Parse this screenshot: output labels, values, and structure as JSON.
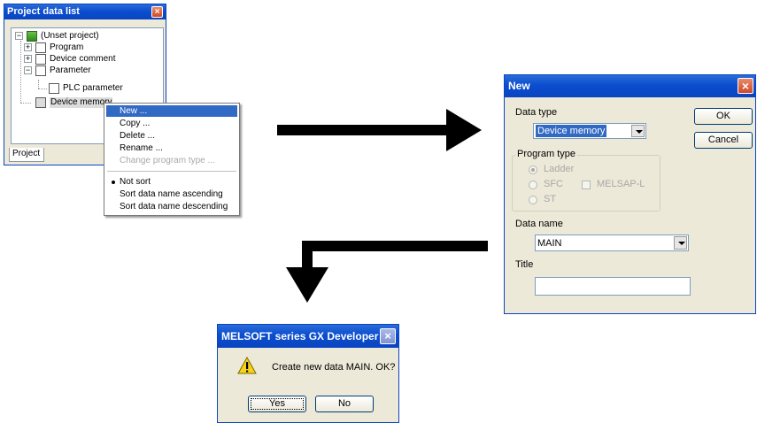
{
  "project_window": {
    "title": "Project data list",
    "tree": {
      "root": "(Unset project)",
      "program": "Program",
      "device_comment": "Device comment",
      "parameter": "Parameter",
      "plc_parameter": "PLC parameter",
      "device_memory": "Device memory"
    },
    "tab": "Project"
  },
  "context_menu": {
    "items": [
      "New ...",
      "Copy ...",
      "Delete ...",
      "Rename ...",
      "Change program type ..."
    ],
    "sort_items": [
      "Not sort",
      "Sort data name ascending",
      "Sort data name descending"
    ]
  },
  "new_dialog": {
    "title": "New",
    "data_type_label": "Data type",
    "data_type_value": "Device memory",
    "ok": "OK",
    "cancel": "Cancel",
    "program_type_label": "Program type",
    "ladder": "Ladder",
    "sfc": "SFC",
    "melsap": "MELSAP-L",
    "st": "ST",
    "data_name_label": "Data name",
    "data_name_value": "MAIN",
    "title_label": "Title",
    "title_value": ""
  },
  "confirm_dialog": {
    "title": "MELSOFT series GX Developer",
    "message": "Create new data MAIN. OK?",
    "yes": "Yes",
    "no": "No"
  },
  "colors": {
    "titlebar": "#0a45c0",
    "menu_highlight": "#316ac5",
    "dialog_bg": "#ece9d8"
  }
}
